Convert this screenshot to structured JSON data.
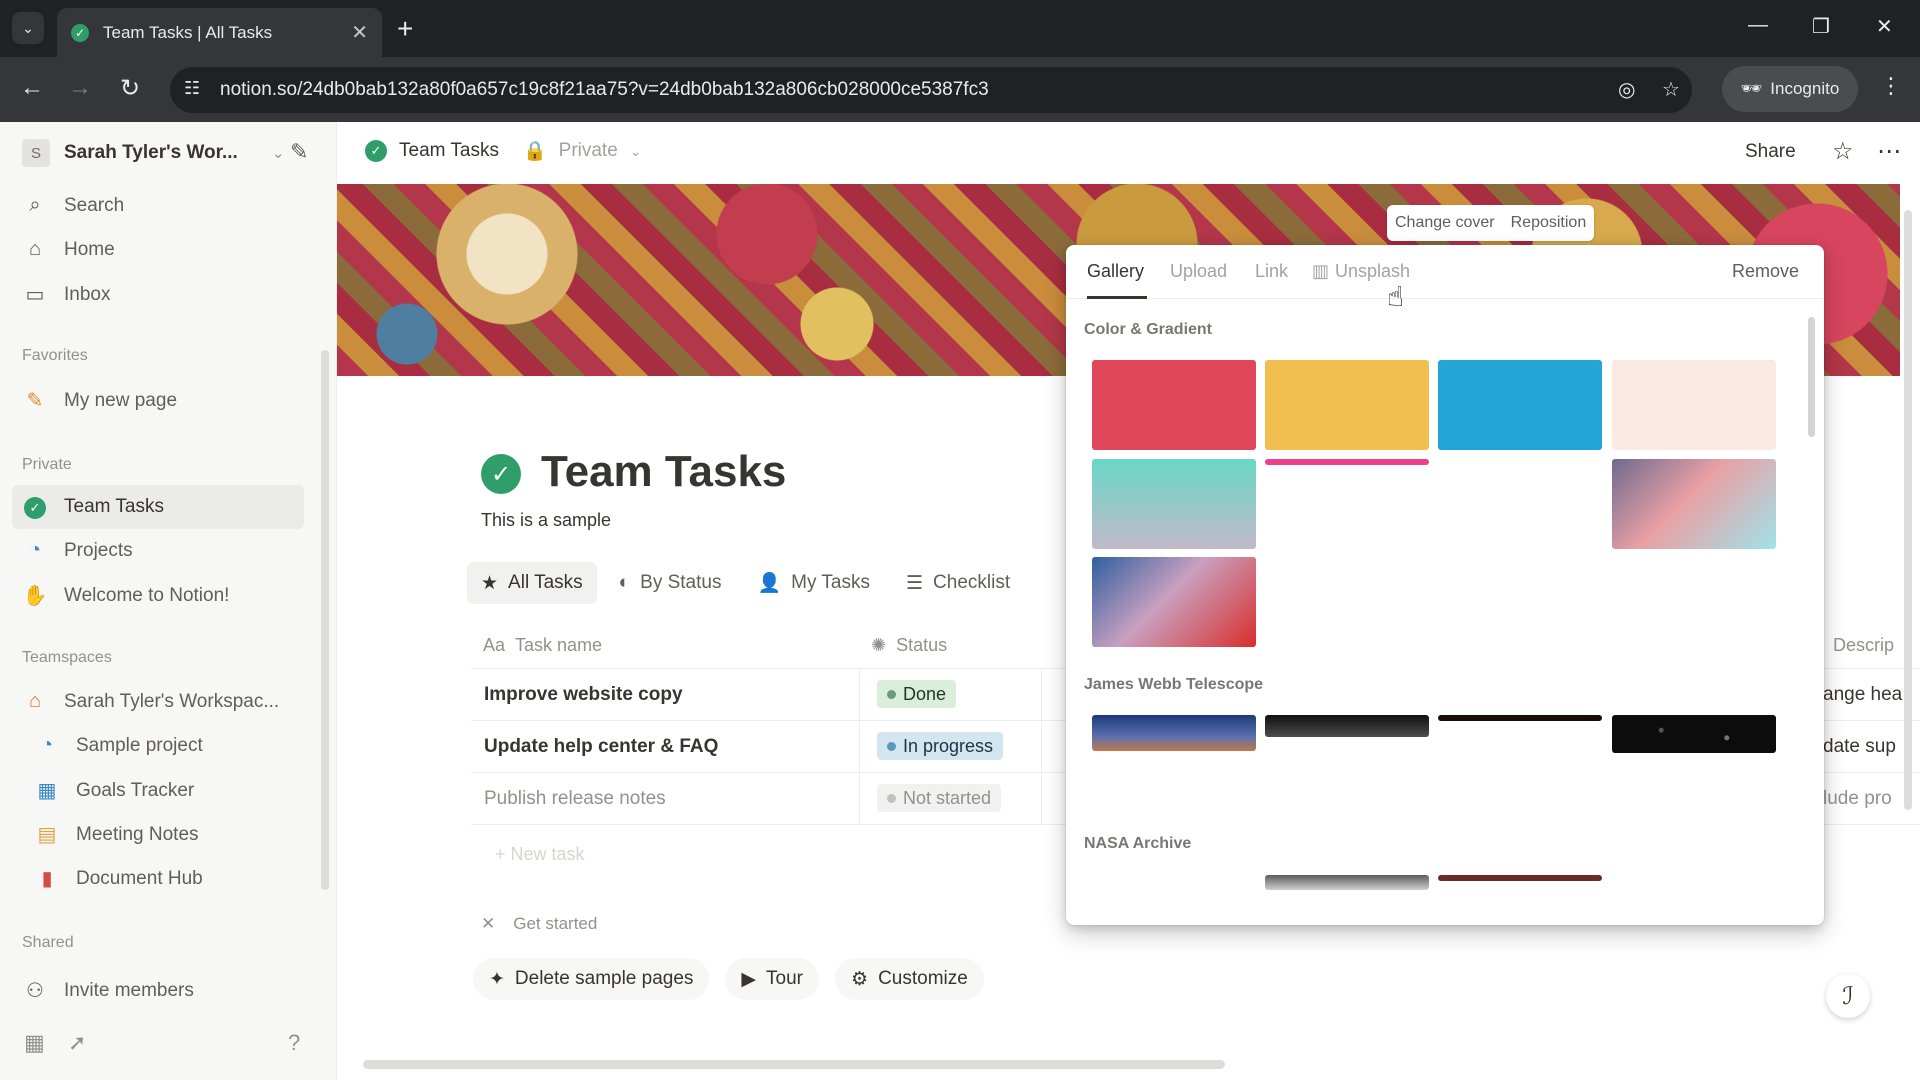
{
  "browser": {
    "tab_title": "Team Tasks | All Tasks",
    "url": "notion.so/24db0bab132a80f0a657c19c8f21aa75?v=24db0bab132a806cb028000ce5387fc3",
    "incognito_label": "Incognito"
  },
  "sidebar": {
    "workspace_initial": "S",
    "workspace_name": "Sarah Tyler's Wor...",
    "nav": [
      {
        "label": "Search",
        "icon": "search-icon"
      },
      {
        "label": "Home",
        "icon": "home-icon"
      },
      {
        "label": "Inbox",
        "icon": "inbox-icon"
      }
    ],
    "favorites_heading": "Favorites",
    "favorites": [
      {
        "label": "My new page",
        "icon": "pencil-icon"
      }
    ],
    "private_heading": "Private",
    "private_items": [
      {
        "label": "Team Tasks",
        "icon": "check-circle-icon"
      },
      {
        "label": "Projects",
        "icon": "projects-icon"
      },
      {
        "label": "Welcome to Notion!",
        "icon": "wave-icon"
      }
    ],
    "teamspaces_heading": "Teamspaces",
    "teamspaces": [
      {
        "label": "Sarah Tyler's Workspac...",
        "icon": "home-icon"
      },
      {
        "label": "Sample project",
        "icon": "projects-icon"
      },
      {
        "label": "Goals Tracker",
        "icon": "chart-icon"
      },
      {
        "label": "Meeting Notes",
        "icon": "calendar-icon"
      },
      {
        "label": "Document Hub",
        "icon": "document-icon"
      }
    ],
    "shared_heading": "Shared",
    "invite_label": "Invite members"
  },
  "topbar": {
    "breadcrumb_title": "Team Tasks",
    "privacy": "Private",
    "share_label": "Share"
  },
  "cover": {
    "change_label": "Change cover",
    "reposition_label": "Reposition"
  },
  "page": {
    "title": "Team Tasks",
    "description": "This is a sample",
    "views": [
      {
        "label": "All Tasks",
        "icon": "star-icon"
      },
      {
        "label": "By Status",
        "icon": "status-icon"
      },
      {
        "label": "My Tasks",
        "icon": "person-icon"
      },
      {
        "label": "Checklist",
        "icon": "checklist-icon"
      }
    ],
    "columns": {
      "name": "Task name",
      "name_prefix": "Aa",
      "status": "Status",
      "description": "Descrip"
    },
    "rows": [
      {
        "name": "Improve website copy",
        "status": "Done",
        "desc": "ange hea"
      },
      {
        "name": "Update help center & FAQ",
        "status": "In progress",
        "desc": "date sup"
      },
      {
        "name": "Publish release notes",
        "status": "Not started",
        "desc": "lude pro"
      }
    ],
    "new_row": "+ New task",
    "get_started": "Get started",
    "actions": [
      {
        "label": "Delete sample pages",
        "icon": "sparkle-icon"
      },
      {
        "label": "Tour",
        "icon": "play-icon"
      },
      {
        "label": "Customize",
        "icon": "gear-icon"
      }
    ]
  },
  "picker": {
    "tabs": [
      "Gallery",
      "Upload",
      "Link",
      "Unsplash"
    ],
    "remove_label": "Remove",
    "sections": [
      "Color & Gradient",
      "James Webb Telescope",
      "NASA Archive"
    ]
  },
  "colors": {
    "done_bg": "#dbeddb",
    "done_dot": "#6c9b7d",
    "progress_bg": "#d3e5ef",
    "progress_dot": "#5b97bd",
    "notstarted_bg": "#f1f1ef",
    "notstarted_dot": "#c3c2c1",
    "accent": "#2f9e6b"
  }
}
